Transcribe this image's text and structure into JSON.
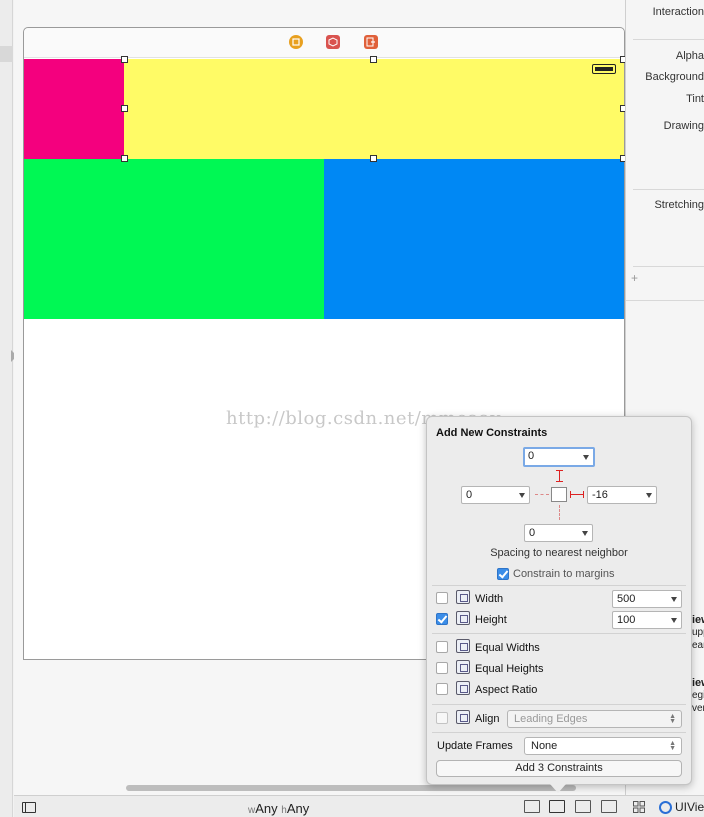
{
  "inspector": {
    "labels": [
      "Interaction",
      "Alpha",
      "Background",
      "Tint",
      "Drawing",
      "Stretching"
    ],
    "add_symbol": "+",
    "fragments": [
      "iew",
      "upp",
      "ean",
      "iew",
      "egio",
      "ver"
    ],
    "bottom_label": "UIView"
  },
  "canvas": {
    "watermark": "http://blog.csdn.net/mmoaay",
    "colors": {
      "pink": "#f4007e",
      "yellow": "#fffb66",
      "green": "#00f854",
      "blue": "#0088f4"
    }
  },
  "bottom_bar": {
    "w_prefix": "w",
    "w_value": "Any",
    "h_prefix": "h",
    "h_value": "Any"
  },
  "popover": {
    "title": "Add New Constraints",
    "top_value": "0",
    "left_value": "0",
    "right_value": "-16",
    "bottom_value": "0",
    "spacing_label": "Spacing to nearest neighbor",
    "constrain_label": "Constrain to margins",
    "constrain_checked": true,
    "width": {
      "label": "Width",
      "value": "500",
      "checked": false
    },
    "height": {
      "label": "Height",
      "value": "100",
      "checked": true
    },
    "equal_widths": "Equal Widths",
    "equal_heights": "Equal Heights",
    "aspect_ratio": "Aspect Ratio",
    "align": {
      "label": "Align",
      "value": "Leading Edges"
    },
    "update_frames": {
      "label": "Update Frames",
      "value": "None"
    },
    "add_button": "Add 3 Constraints"
  }
}
